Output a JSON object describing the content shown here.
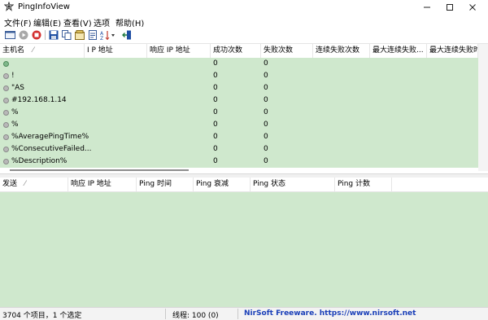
{
  "window": {
    "title": "PingInfoView"
  },
  "menu": [
    "文件(F)",
    "编辑(E)",
    "查看(V)",
    "选项",
    "帮助(H)"
  ],
  "toolbar": {
    "icons": [
      "new-icon",
      "play-icon",
      "stop-icon",
      "save-icon",
      "copy-icon",
      "properties-icon",
      "html-report-icon",
      "sort-icon",
      "exit-icon"
    ],
    "colors": {
      "stop": "#d32f2f",
      "save": "#1f4fa3",
      "play": "#9e9e9e"
    }
  },
  "upper_table": {
    "columns": [
      "主机名",
      "I P 地址",
      "响应 IP 地址",
      "成功次数",
      "失败次数",
      "连续失败次数",
      "最大连续失败...",
      "最大连续失败时"
    ],
    "rows": [
      {
        "host": "",
        "success": "0",
        "fail": "0"
      },
      {
        "host": "!",
        "success": "0",
        "fail": "0"
      },
      {
        "host": "\"AS",
        "success": "0",
        "fail": "0"
      },
      {
        "host": "#192.168.1.14",
        "success": "0",
        "fail": "0"
      },
      {
        "host": "%",
        "success": "0",
        "fail": "0"
      },
      {
        "host": "%",
        "success": "0",
        "fail": "0"
      },
      {
        "host": "%AveragePingTime%",
        "success": "0",
        "fail": "0"
      },
      {
        "host": "%ConsecutiveFailed...",
        "success": "0",
        "fail": "0"
      },
      {
        "host": "%Description%",
        "success": "0",
        "fail": "0"
      }
    ],
    "row_color": "#cfe8cd"
  },
  "lower_table": {
    "columns": [
      "发送",
      "响应 IP 地址",
      "Ping 时间",
      "Ping 衰减",
      "Ping 状态",
      "Ping 计数"
    ],
    "bg_color": "#cfe8cd"
  },
  "status": {
    "items": "3704 个项目，1 个选定",
    "threads": "线程: 100 (0)",
    "credit": "NirSoft Freeware. https://www.nirsoft.net",
    "credit_color": "#1a3fb8"
  }
}
